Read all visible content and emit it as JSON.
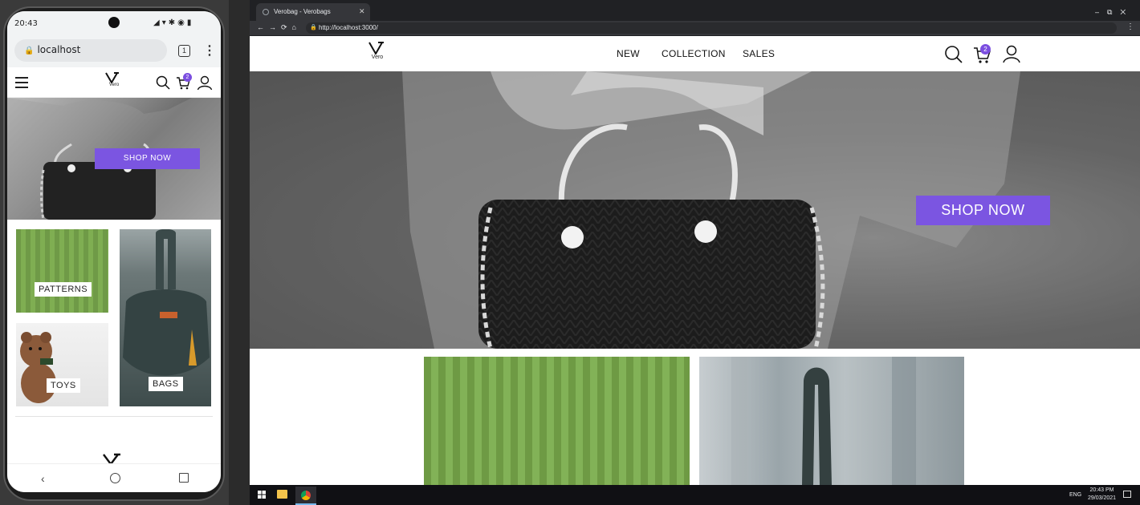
{
  "phone": {
    "status_time": "20:43",
    "url": "localhost",
    "tab_count": "1",
    "brand": "Vero",
    "cart_count": "2",
    "hero_button": "SHOP NOW",
    "tiles": [
      "PATTERNS",
      "TOYS",
      "BAGS"
    ]
  },
  "desktop": {
    "tab_title": "Verobag - Verobags",
    "url": "http://localhost:3000/",
    "brand": "Vero",
    "nav": [
      "NEW",
      "COLLECTION",
      "SALES"
    ],
    "cart_count": "2",
    "hero_button": "SHOP NOW",
    "taskbar": {
      "lang": "ENG",
      "time": "20:43 PM",
      "date": "29/03/2021"
    }
  },
  "colors": {
    "accent": "#7b55e1"
  }
}
